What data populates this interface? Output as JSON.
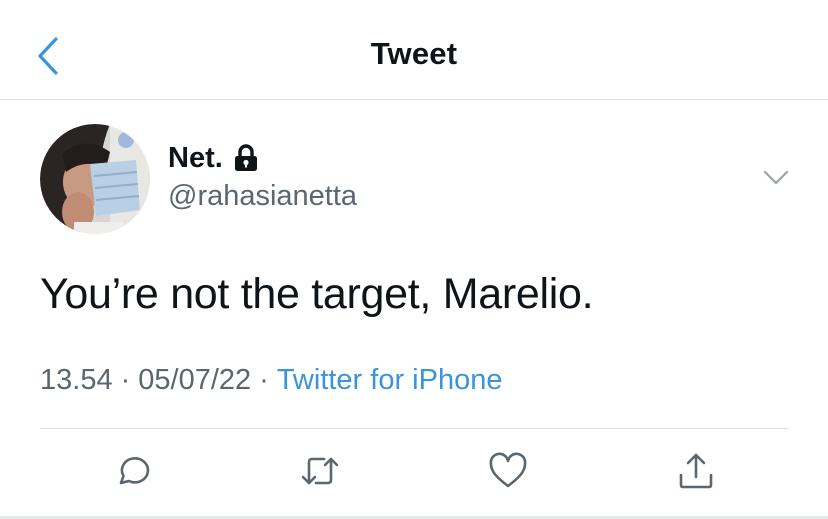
{
  "header": {
    "title": "Tweet",
    "back_icon": "chevron-left-icon"
  },
  "author": {
    "display_name": "Net.",
    "handle": "@rahasianetta",
    "protected_icon": "lock-icon"
  },
  "tweet": {
    "text": "You’re not the target, Marelio.",
    "time": "13.54",
    "date": "05/07/22",
    "separator": "·",
    "source": "Twitter for iPhone"
  },
  "actions": [
    {
      "name": "reply",
      "icon": "reply-icon"
    },
    {
      "name": "retweet",
      "icon": "retweet-icon"
    },
    {
      "name": "like",
      "icon": "heart-icon"
    },
    {
      "name": "share",
      "icon": "share-icon"
    }
  ],
  "colors": {
    "accent": "#3b94d9",
    "text": "#0f1419",
    "secondary": "#5b6670",
    "divider": "#d8dde2"
  }
}
